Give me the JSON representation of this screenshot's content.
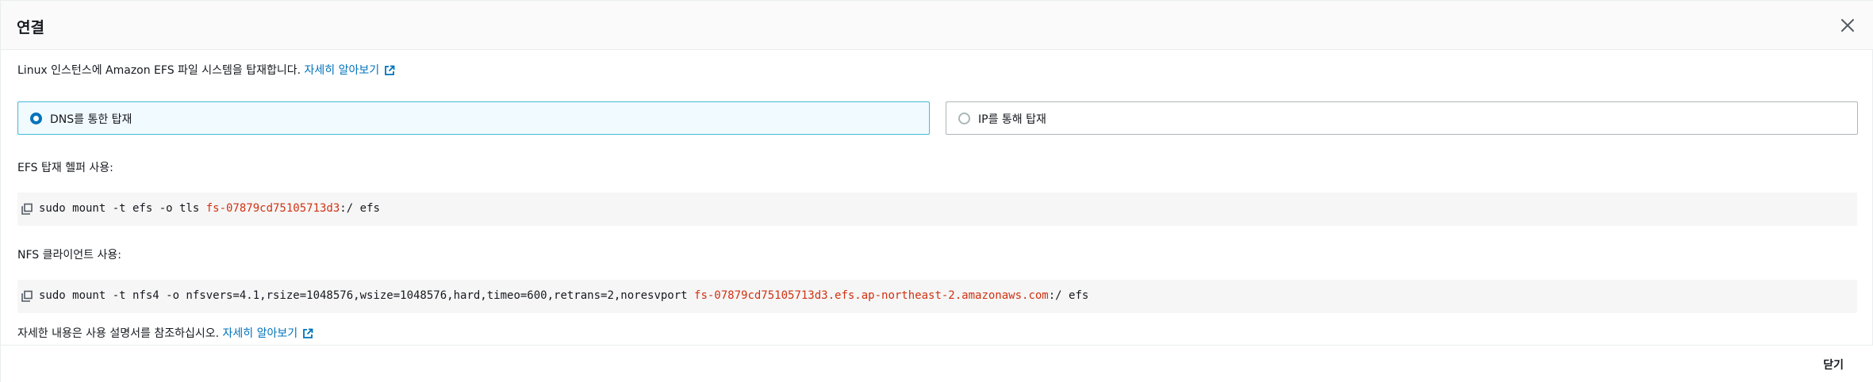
{
  "modal": {
    "title": "연결",
    "intro_text": "Linux 인스턴스에 Amazon EFS 파일 시스템을 탑재합니다.",
    "intro_link": "자세히 알아보기",
    "options": [
      {
        "label": "DNS를 통한 탑재",
        "selected": true
      },
      {
        "label": "IP를 통해 탑재",
        "selected": false
      }
    ],
    "efs_helper": {
      "label": "EFS 탑재 헬퍼 사용:",
      "cmd_prefix": "sudo mount -t efs -o tls ",
      "cmd_highlight": "fs-07879cd75105713d3",
      "cmd_suffix": ":/ efs"
    },
    "nfs_client": {
      "label": "NFS 클라이언트 사용:",
      "cmd_prefix": "sudo mount -t nfs4 -o nfsvers=4.1,rsize=1048576,wsize=1048576,hard,timeo=600,retrans=2,noresvport ",
      "cmd_highlight": "fs-07879cd75105713d3.efs.ap-northeast-2.amazonaws.com",
      "cmd_suffix": ":/ efs"
    },
    "footnote_text": "자세한 내용은 사용 설명서를 참조하십시오.",
    "footnote_link": "자세히 알아보기",
    "close_button": "닫기"
  },
  "colors": {
    "link": "#0073bb",
    "highlight": "#d13212",
    "selected_border": "#44b9d6"
  },
  "icons": [
    "close-icon",
    "external-link-icon",
    "copy-icon",
    "radio-icon"
  ]
}
